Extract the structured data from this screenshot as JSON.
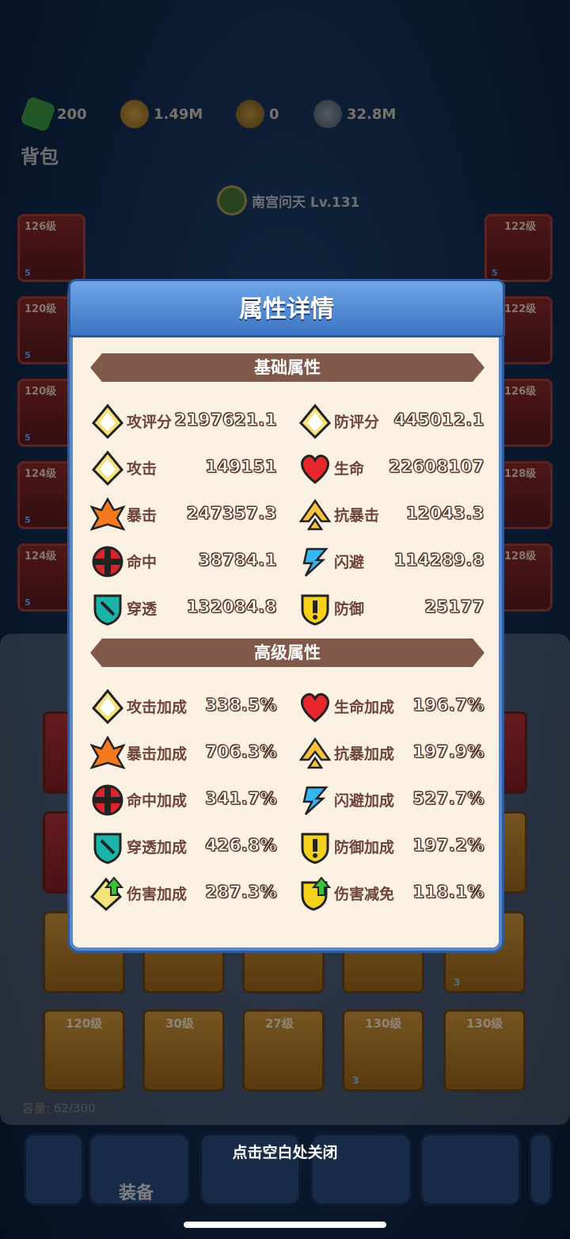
{
  "currencies": {
    "gems": "200",
    "gold": "1.49M",
    "token": "0",
    "silver": "32.8M"
  },
  "bag_title": "背包",
  "hero": {
    "name_level": "南宫问天 Lv.131"
  },
  "left_slots": [
    {
      "level": "126级",
      "stars": "5"
    },
    {
      "level": "120级",
      "stars": "5"
    },
    {
      "level": "120级",
      "stars": "5"
    },
    {
      "level": "124级",
      "stars": "5"
    },
    {
      "level": "124级",
      "stars": "5"
    }
  ],
  "right_slots": [
    {
      "level": "122级",
      "stars": "5"
    },
    {
      "level": "122级",
      "stars": "5"
    },
    {
      "level": "126级",
      "stars": "5"
    },
    {
      "level": "128级",
      "stars": "5"
    },
    {
      "level": "128级",
      "stars": "5"
    }
  ],
  "inventory_bottom": [
    {
      "level": "120级",
      "stars": ""
    },
    {
      "level": "30级",
      "stars": ""
    },
    {
      "level": "27级",
      "stars": ""
    },
    {
      "level": "130级",
      "stars": "3"
    },
    {
      "level": "130级",
      "stars": ""
    }
  ],
  "inventory_mid_stars": "3",
  "capacity": "容量: 62/300",
  "nav": {
    "equip_label": "装备"
  },
  "close_hint": "点击空白处关闭",
  "modal": {
    "title": "属性详情",
    "basic_section": "基础属性",
    "advanced_section": "高级属性",
    "basic_left": [
      {
        "icon": "attack-score-icon",
        "name": "攻评分",
        "value": "2197621.1"
      },
      {
        "icon": "attack-icon",
        "name": "攻击",
        "value": "149151"
      },
      {
        "icon": "crit-icon",
        "name": "暴击",
        "value": "247357.3"
      },
      {
        "icon": "hit-icon",
        "name": "命中",
        "value": "38784.1"
      },
      {
        "icon": "penetration-icon",
        "name": "穿透",
        "value": "132084.8"
      }
    ],
    "basic_right": [
      {
        "icon": "defense-score-icon",
        "name": "防评分",
        "value": "445012.1"
      },
      {
        "icon": "heart-icon",
        "name": "生命",
        "value": "22608107"
      },
      {
        "icon": "anti-crit-icon",
        "name": "抗暴击",
        "value": "12043.3"
      },
      {
        "icon": "dodge-icon",
        "name": "闪避",
        "value": "114289.8"
      },
      {
        "icon": "shield-icon",
        "name": "防御",
        "value": "25177"
      }
    ],
    "adv_left": [
      {
        "icon": "attack-icon",
        "name": "攻击加成",
        "value": "338.5%"
      },
      {
        "icon": "crit-icon",
        "name": "暴击加成",
        "value": "706.3%"
      },
      {
        "icon": "hit-icon",
        "name": "命中加成",
        "value": "341.7%"
      },
      {
        "icon": "penetration-icon",
        "name": "穿透加成",
        "value": "426.8%"
      },
      {
        "icon": "damage-up-icon",
        "name": "伤害加成",
        "value": "287.3%"
      }
    ],
    "adv_right": [
      {
        "icon": "heart-icon",
        "name": "生命加成",
        "value": "196.7%"
      },
      {
        "icon": "anti-crit-icon",
        "name": "抗暴加成",
        "value": "197.9%"
      },
      {
        "icon": "dodge-icon",
        "name": "闪避加成",
        "value": "527.7%"
      },
      {
        "icon": "shield-icon",
        "name": "防御加成",
        "value": "197.2%"
      },
      {
        "icon": "damage-reduce-icon",
        "name": "伤害减免",
        "value": "118.1%"
      }
    ]
  }
}
